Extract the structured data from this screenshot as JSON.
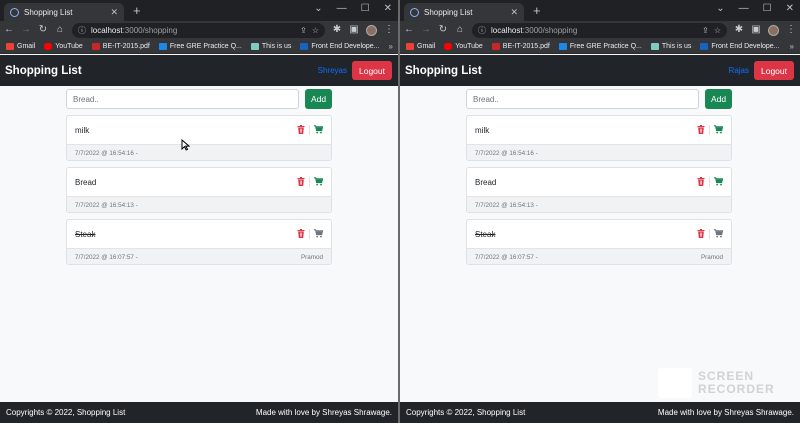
{
  "windows": [
    {
      "browser": {
        "tab_title": "Shopping List",
        "url_host": "localhost",
        "url_path": ":3000/shopping",
        "bookmarks": [
          {
            "label": "Gmail",
            "color": "#ea4335"
          },
          {
            "label": "YouTube",
            "color": "#ff0000"
          },
          {
            "label": "BE-IT-2015.pdf",
            "color": "#c62828"
          },
          {
            "label": "Free GRE Practice Q...",
            "color": "#1e88e5"
          },
          {
            "label": "This is us",
            "color": "#80cbc4"
          },
          {
            "label": "Front End Develope...",
            "color": "#1565c0"
          }
        ]
      },
      "app": {
        "brand": "Shopping List",
        "user": "Shreyas",
        "logout_label": "Logout",
        "search_placeholder": "Bread..",
        "add_label": "Add",
        "items": [
          {
            "name": "milk",
            "timestamp": "7/7/2022 @ 16:54:16 -",
            "by": "",
            "purchased": false
          },
          {
            "name": "Bread",
            "timestamp": "7/7/2022 @ 16:54:13 -",
            "by": "",
            "purchased": false
          },
          {
            "name": "Steak",
            "timestamp": "7/7/2022 @ 16:07:57 -",
            "by": "Pramod",
            "purchased": true
          }
        ],
        "footer_left": "Copyrights © 2022, Shopping List",
        "footer_right": "Made with love by Shreyas Shrawage."
      }
    },
    {
      "browser": {
        "tab_title": "Shopping List",
        "url_host": "localhost",
        "url_path": ":3000/shopping",
        "bookmarks": [
          {
            "label": "Gmail",
            "color": "#ea4335"
          },
          {
            "label": "YouTube",
            "color": "#ff0000"
          },
          {
            "label": "BE-IT-2015.pdf",
            "color": "#c62828"
          },
          {
            "label": "Free GRE Practice Q...",
            "color": "#1e88e5"
          },
          {
            "label": "This is us",
            "color": "#80cbc4"
          },
          {
            "label": "Front End Develope...",
            "color": "#1565c0"
          }
        ]
      },
      "app": {
        "brand": "Shopping List",
        "user": "Rajas",
        "logout_label": "Logout",
        "search_placeholder": "Bread..",
        "add_label": "Add",
        "items": [
          {
            "name": "milk",
            "timestamp": "7/7/2022 @ 16:54:16 -",
            "by": "",
            "purchased": false
          },
          {
            "name": "Bread",
            "timestamp": "7/7/2022 @ 16:54:13 -",
            "by": "",
            "purchased": false
          },
          {
            "name": "Steak",
            "timestamp": "7/7/2022 @ 16:07:57 -",
            "by": "Pramod",
            "purchased": true
          }
        ],
        "footer_left": "Copyrights © 2022, Shopping List",
        "footer_right": "Made with love by Shreyas Shrawage."
      }
    }
  ],
  "colors": {
    "danger": "#dc3545",
    "success": "#198754",
    "link": "#0d6efd",
    "dark": "#212529",
    "muted_cart": "#6c757d"
  },
  "watermark": {
    "line1": "SCREEN",
    "line2": "RECORDER"
  }
}
